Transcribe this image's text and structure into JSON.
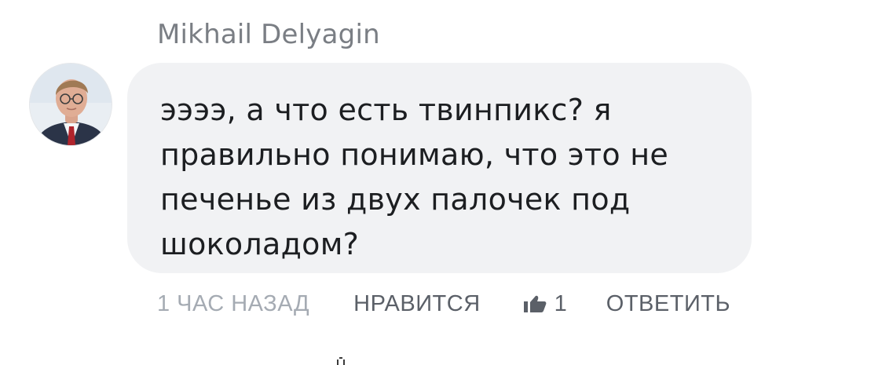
{
  "comment": {
    "author": "Mikhail Delyagin",
    "text": "ээээ, а что есть твинпикс? я\nправильно понимаю, что это не\nпеченье из двух палочек под\nшоколадом?",
    "timestamp": "1 ЧАС НАЗАД",
    "like_label": "НРАВИТСЯ",
    "like_count": "1",
    "reply_label": "ОТВЕТИТЬ"
  },
  "icons": {
    "like_count": "thumbs-up-icon"
  },
  "colors": {
    "bubble_bg": "#f1f2f4",
    "author": "#7a7e84",
    "meta": "#a5abb3",
    "action": "#5b6068",
    "text": "#1c1e21"
  }
}
